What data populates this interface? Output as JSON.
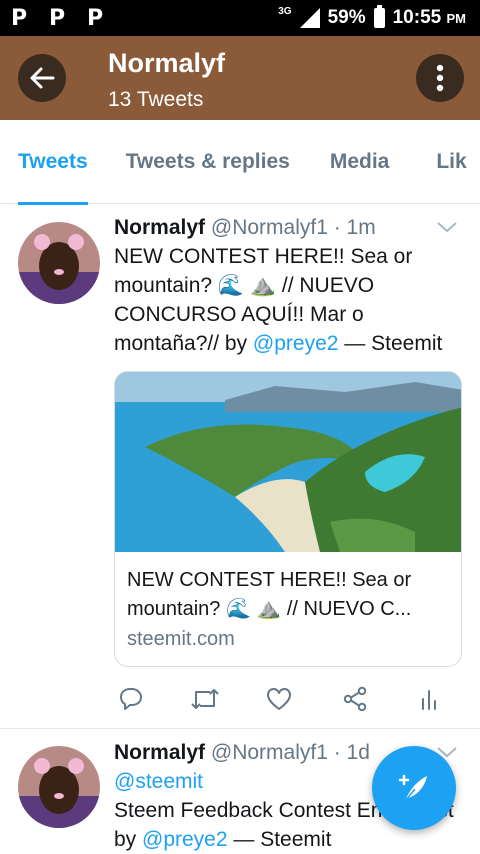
{
  "status_bar": {
    "notification_icons": [
      "P",
      "P",
      "P"
    ],
    "network": "3G",
    "battery": "59%",
    "time": "10:55",
    "ampm": "PM"
  },
  "header": {
    "title": "Normalyf",
    "subtitle": "13 Tweets"
  },
  "tabs": [
    {
      "label": "Tweets",
      "active": true
    },
    {
      "label": "Tweets & replies",
      "active": false
    },
    {
      "label": "Media",
      "active": false
    },
    {
      "label": "Lik",
      "active": false
    }
  ],
  "tweets": [
    {
      "name": "Normalyf",
      "handle": "@Normalyf1",
      "time": "· 1m",
      "text_parts": [
        "NEW CONTEST HERE!! Sea or mountain? 🌊 ⛰️ // NUEVO CONCURSO AQUÍ!! Mar o montaña?// by ",
        "@preye2",
        " — Steemit"
      ],
      "card": {
        "title": "NEW CONTEST HERE!! Sea or mountain? 🌊 ⛰️ // NUEVO C...",
        "domain": "steemit.com"
      }
    },
    {
      "name": "Normalyf",
      "handle": "@Normalyf1",
      "time": "· 1d",
      "mention": "@steemit",
      "text_line": "Steem Feedback Contest Entry Post",
      "by": "by ",
      "author": "@preye2",
      "suffix": " — Steemit"
    }
  ],
  "icons": {
    "back": "arrow-left-icon",
    "more": "vertical-dots-icon",
    "caret": "chevron-down-icon",
    "reply": "reply-icon",
    "retweet": "retweet-icon",
    "like": "heart-icon",
    "share": "share-icon",
    "analytics": "analytics-icon",
    "compose": "compose-feather-icon"
  },
  "colors": {
    "header": "#8b5a39",
    "accent": "#1da1f2",
    "muted": "#657786"
  }
}
